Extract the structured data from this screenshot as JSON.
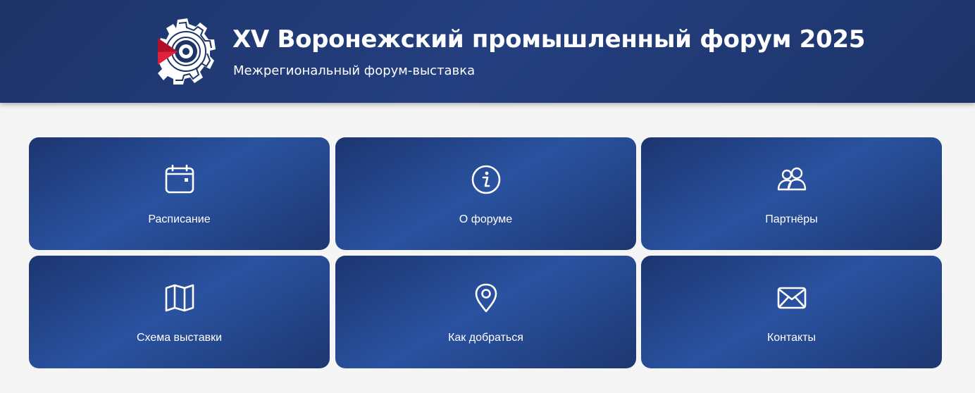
{
  "header": {
    "title": "XV Воронежский промышленный форум 2025",
    "subtitle": "Межрегиональный форум-выставка",
    "logo_icon": "gear-logo-icon",
    "background": "#1d3468"
  },
  "tiles": [
    {
      "label": "Расписание",
      "icon": "calendar-icon"
    },
    {
      "label": "О форуме",
      "icon": "info-icon"
    },
    {
      "label": "Партнёры",
      "icon": "users-icon"
    },
    {
      "label": "Схема выставки",
      "icon": "map-icon"
    },
    {
      "label": "Как добраться",
      "icon": "location-pin-icon"
    },
    {
      "label": "Контакты",
      "icon": "envelope-icon"
    }
  ],
  "colors": {
    "tile_dark": "#1c3570",
    "tile_light": "#2a52a0",
    "accent_red": "#e0213a",
    "page_background": "#f5f5f5"
  }
}
